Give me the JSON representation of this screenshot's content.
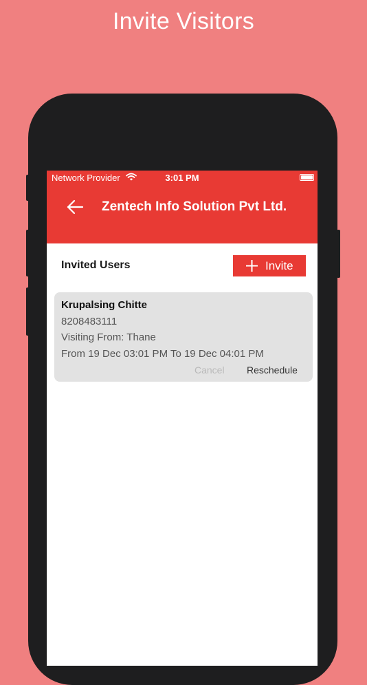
{
  "promo": {
    "title": "Invite Visitors"
  },
  "status_bar": {
    "provider": "Network Provider",
    "time": "3:01 PM",
    "wifi_icon": "wifi-icon",
    "battery_icon": "battery-icon"
  },
  "app_bar": {
    "back_icon": "arrow-left-icon",
    "title": "Zentech Info Solution Pvt Ltd."
  },
  "invited_users": {
    "heading": "Invited Users",
    "invite_button": {
      "icon": "plus-icon",
      "label": "Invite"
    },
    "cards": [
      {
        "name": "Krupalsing Chitte",
        "phone": "8208483111",
        "visiting_from": "Visiting From: Thane",
        "time_range": "From 19 Dec 03:01 PM To 19 Dec 04:01 PM",
        "cancel_label": "Cancel",
        "reschedule_label": "Reschedule"
      }
    ]
  },
  "colors": {
    "background": "#f08080",
    "primary": "#e83a34",
    "card": "#e2e2e2",
    "phone_frame": "#1e1e1f",
    "disabled_text": "#b9b9b9"
  }
}
